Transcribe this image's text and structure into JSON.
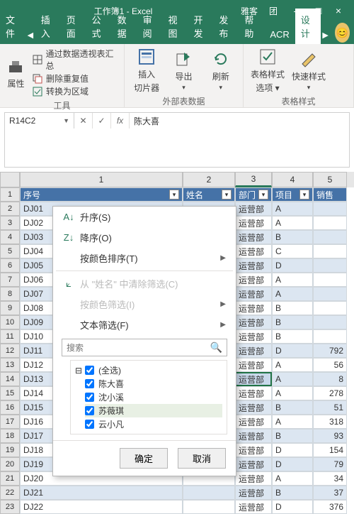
{
  "title": {
    "doc": "工作簿1 - Excel",
    "right": "雅客",
    "team": "团"
  },
  "winbtns": {
    "min": "—",
    "max": "□",
    "close": "×"
  },
  "tabs": {
    "file": "文件",
    "items": [
      "插入",
      "页面",
      "公式",
      "数据",
      "审阅",
      "视图",
      "开发",
      "发布",
      "帮助",
      "ACR",
      "设计"
    ],
    "nav_left": "◀",
    "nav_right": "▶"
  },
  "ribbon": {
    "g1": {
      "prop": "属性",
      "pivot": "通过数据透视表汇总",
      "dedup": "删除重复值",
      "range": "转换为区域",
      "label": "工具"
    },
    "g2": {
      "slicer_top": "插入",
      "slicer_bot": "切片器",
      "export": "导出",
      "refresh": "刷新",
      "label": "外部表数据"
    },
    "g3": {
      "styleopt_top": "表格样式",
      "styleopt_bot": "选项 ▾",
      "quick": "快速样式",
      "label": "表格样式"
    }
  },
  "namebox": {
    "ref": "R14C2",
    "cancel": "✕",
    "ok": "✓",
    "fx": "fx",
    "value": "陈大喜"
  },
  "headers": {
    "c1": "序号",
    "c2": "姓名",
    "c3": "部门",
    "c4": "项目",
    "c5": "销售"
  },
  "cols": [
    "1",
    "2",
    "3",
    "4",
    "5"
  ],
  "rows": [
    {
      "n": 2,
      "id": "DJ01",
      "dept": "运营部",
      "proj": "A",
      "sale": ""
    },
    {
      "n": 3,
      "id": "DJ02",
      "dept": "运营部",
      "proj": "A",
      "sale": ""
    },
    {
      "n": 4,
      "id": "DJ03",
      "dept": "运营部",
      "proj": "B",
      "sale": ""
    },
    {
      "n": 5,
      "id": "DJ04",
      "dept": "运营部",
      "proj": "C",
      "sale": ""
    },
    {
      "n": 6,
      "id": "DJ05",
      "dept": "运营部",
      "proj": "D",
      "sale": ""
    },
    {
      "n": 7,
      "id": "DJ06",
      "dept": "运营部",
      "proj": "A",
      "sale": ""
    },
    {
      "n": 8,
      "id": "DJ07",
      "dept": "运营部",
      "proj": "A",
      "sale": ""
    },
    {
      "n": 9,
      "id": "DJ08",
      "dept": "运营部",
      "proj": "B",
      "sale": ""
    },
    {
      "n": 10,
      "id": "DJ09",
      "dept": "运营部",
      "proj": "B",
      "sale": ""
    },
    {
      "n": 11,
      "id": "DJ10",
      "dept": "运营部",
      "proj": "B",
      "sale": ""
    },
    {
      "n": 12,
      "id": "DJ11",
      "dept": "运营部",
      "proj": "D",
      "sale": "792"
    },
    {
      "n": 13,
      "id": "DJ12",
      "dept": "运营部",
      "proj": "A",
      "sale": "56"
    },
    {
      "n": 14,
      "id": "DJ13",
      "dept": "运营部",
      "proj": "A",
      "sale": "8"
    },
    {
      "n": 15,
      "id": "DJ14",
      "dept": "运营部",
      "proj": "A",
      "sale": "278"
    },
    {
      "n": 16,
      "id": "DJ15",
      "dept": "运营部",
      "proj": "B",
      "sale": "51"
    },
    {
      "n": 17,
      "id": "DJ16",
      "dept": "运营部",
      "proj": "A",
      "sale": "318"
    },
    {
      "n": 18,
      "id": "DJ17",
      "dept": "运营部",
      "proj": "B",
      "sale": "93"
    },
    {
      "n": 19,
      "id": "DJ18",
      "dept": "运营部",
      "proj": "D",
      "sale": "154"
    },
    {
      "n": 20,
      "id": "DJ19",
      "dept": "运营部",
      "proj": "D",
      "sale": "79"
    },
    {
      "n": 21,
      "id": "DJ20",
      "dept": "运营部",
      "proj": "A",
      "sale": "34"
    },
    {
      "n": 22,
      "id": "DJ21",
      "dept": "运营部",
      "proj": "B",
      "sale": "37"
    },
    {
      "n": 23,
      "id": "DJ22",
      "dept": "运营部",
      "proj": "D",
      "sale": "376"
    }
  ],
  "filter": {
    "sort_asc": "升序(S)",
    "sort_desc": "降序(O)",
    "sort_color": "按颜色排序(T)",
    "clear": "从 \"姓名\" 中清除筛选(C)",
    "filter_color": "按颜色筛选(I)",
    "text_filter": "文本筛选(F)",
    "search_ph": "搜索",
    "all": "(全选)",
    "n1": "陈大喜",
    "n2": "沈小溪",
    "n3": "苏薇琪",
    "n4": "云小凡",
    "ok": "确定",
    "cancel": "取消"
  }
}
